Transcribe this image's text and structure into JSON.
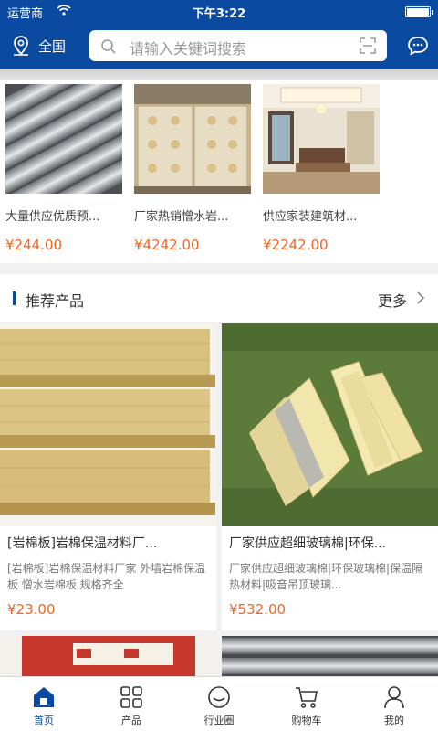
{
  "status_bar": {
    "carrier": "运营商",
    "time": "下午3:22"
  },
  "header": {
    "location": "全国",
    "search_placeholder": "请输入关键词搜索"
  },
  "hot_products": [
    {
      "name": "大量供应优质预...",
      "price": "¥244.00"
    },
    {
      "name": "厂家热销憎水岩...",
      "price": "¥4242.00"
    },
    {
      "name": "供应家装建筑材...",
      "price": "¥2242.00"
    }
  ],
  "recommend": {
    "title": "推荐产品",
    "more": "更多",
    "items": [
      {
        "title": "[岩棉板]岩棉保温材料厂...",
        "desc": "[岩棉板]岩棉保温材料厂家 外墙岩棉保温板 憎水岩棉板 规格齐全",
        "price": "¥23.00"
      },
      {
        "title": "厂家供应超细玻璃棉|环保...",
        "desc": "厂家供应超细玻璃棉|环保玻璃棉|保温隔热材料|吸音吊顶玻璃...",
        "price": "¥532.00"
      }
    ]
  },
  "tabs": [
    {
      "label": "首页",
      "icon": "home-icon",
      "active": true
    },
    {
      "label": "产品",
      "icon": "grid-icon",
      "active": false
    },
    {
      "label": "行业圈",
      "icon": "circle-icon",
      "active": false
    },
    {
      "label": "购物车",
      "icon": "cart-icon",
      "active": false
    },
    {
      "label": "我的",
      "icon": "user-icon",
      "active": false
    }
  ],
  "colors": {
    "brand": "#0a4aa1",
    "price": "#f26522"
  }
}
